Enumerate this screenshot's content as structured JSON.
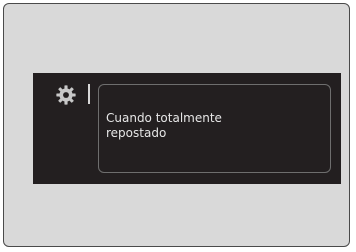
{
  "display": {
    "settings_icon": "gear-icon",
    "message": "Cuando totalmente\nrepostado"
  },
  "colors": {
    "screen_background": "#231f20",
    "outer_panel": "#d9d9d9",
    "text": "#e6e6e6",
    "box_border": "#6e6e6e"
  }
}
